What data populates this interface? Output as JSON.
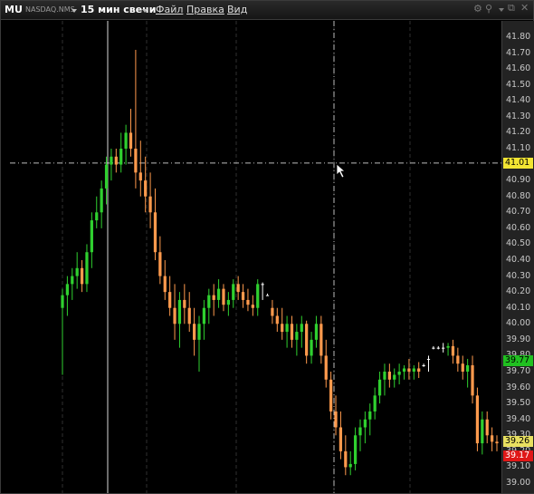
{
  "toolbar": {
    "symbol": "MU",
    "exchange": "NASDAQ.NMS",
    "interval": "15 мин свечи",
    "menu": [
      "Файл",
      "Правка",
      "Вид"
    ]
  },
  "price_axis": {
    "ticks": [
      "41.80",
      "41.70",
      "41.60",
      "41.50",
      "41.40",
      "41.30",
      "41.20",
      "41.10",
      "41.00",
      "40.90",
      "40.80",
      "40.70",
      "40.60",
      "40.50",
      "40.40",
      "40.30",
      "40.20",
      "40.10",
      "40.00",
      "39.90",
      "39.80",
      "39.70",
      "39.60",
      "39.50",
      "39.40",
      "39.30",
      "39.20",
      "39.10",
      "39.00"
    ],
    "crosshair_price": "41.01",
    "last_price": "39.26",
    "bid_price": "39.77",
    "ask_price": "39.17"
  },
  "colors": {
    "background": "#000000",
    "grid": "#303030",
    "up": "#2fd02f",
    "down": "#ff9a4d",
    "neutral": "#ffffff",
    "crosshair_label": "#f2e533",
    "bid_label": "#20c020",
    "ask_label": "#e01818"
  },
  "chart_data": {
    "type": "candlestick",
    "symbol": "MU",
    "interval": "15 мин",
    "ylim": [
      38.95,
      41.85
    ],
    "crosshair_y": 41.01,
    "candles": [
      [
        40.1,
        40.22,
        39.68,
        40.18
      ],
      [
        40.18,
        40.3,
        40.05,
        40.25
      ],
      [
        40.25,
        40.35,
        40.15,
        40.3
      ],
      [
        40.3,
        40.45,
        40.22,
        40.35
      ],
      [
        40.35,
        40.4,
        40.2,
        40.25
      ],
      [
        40.25,
        40.5,
        40.2,
        40.45
      ],
      [
        40.45,
        40.7,
        40.35,
        40.65
      ],
      [
        40.65,
        40.8,
        40.6,
        40.7
      ],
      [
        40.7,
        40.9,
        40.6,
        40.85
      ],
      [
        40.85,
        41.05,
        40.75,
        41.0
      ],
      [
        41.0,
        41.1,
        40.9,
        41.05
      ],
      [
        41.05,
        41.1,
        40.95,
        41.0
      ],
      [
        41.0,
        41.2,
        40.95,
        41.1
      ],
      [
        41.1,
        41.25,
        41.0,
        41.2
      ],
      [
        41.2,
        41.35,
        41.05,
        41.1
      ],
      [
        41.1,
        41.72,
        40.85,
        40.95
      ],
      [
        40.95,
        41.15,
        40.8,
        40.9
      ],
      [
        40.9,
        41.05,
        40.7,
        40.8
      ],
      [
        40.8,
        40.95,
        40.6,
        40.7
      ],
      [
        40.7,
        40.85,
        40.4,
        40.45
      ],
      [
        40.45,
        40.55,
        40.25,
        40.3
      ],
      [
        40.3,
        40.4,
        40.15,
        40.2
      ],
      [
        40.2,
        40.3,
        40.05,
        40.1
      ],
      [
        40.1,
        40.25,
        39.9,
        40.0
      ],
      [
        40.0,
        40.2,
        39.85,
        40.15
      ],
      [
        40.15,
        40.25,
        40.0,
        40.1
      ],
      [
        40.1,
        40.2,
        39.95,
        40.0
      ],
      [
        40.0,
        40.1,
        39.8,
        39.9
      ],
      [
        39.9,
        40.05,
        39.7,
        40.0
      ],
      [
        40.0,
        40.15,
        39.9,
        40.1
      ],
      [
        40.1,
        40.22,
        40.0,
        40.18
      ],
      [
        40.18,
        40.25,
        40.05,
        40.15
      ],
      [
        40.15,
        40.28,
        40.1,
        40.22
      ],
      [
        40.22,
        40.25,
        40.08,
        40.12
      ],
      [
        40.12,
        40.2,
        40.05,
        40.15
      ],
      [
        40.15,
        40.28,
        40.1,
        40.25
      ],
      [
        40.25,
        40.3,
        40.15,
        40.2
      ],
      [
        40.2,
        40.25,
        40.1,
        40.15
      ],
      [
        40.15,
        40.22,
        40.08,
        40.12
      ],
      [
        40.12,
        40.18,
        40.05,
        40.1
      ],
      [
        40.1,
        40.28,
        40.05,
        40.25
      ],
      [
        40.25,
        40.26,
        40.15,
        40.25
      ],
      [
        40.18,
        40.19,
        40.18,
        40.18
      ],
      [
        40.1,
        40.15,
        40.0,
        40.05
      ],
      [
        40.05,
        40.1,
        39.95,
        40.0
      ],
      [
        40.0,
        40.1,
        39.9,
        39.95
      ],
      [
        39.95,
        40.05,
        39.85,
        40.0
      ],
      [
        40.0,
        40.05,
        39.85,
        39.9
      ],
      [
        39.9,
        40.0,
        39.8,
        39.95
      ],
      [
        39.95,
        40.05,
        39.85,
        40.0
      ],
      [
        40.0,
        40.02,
        39.75,
        39.8
      ],
      [
        39.8,
        39.95,
        39.75,
        39.9
      ],
      [
        39.9,
        40.05,
        39.85,
        40.0
      ],
      [
        40.0,
        40.05,
        39.75,
        39.8
      ],
      [
        39.8,
        39.9,
        39.6,
        39.65
      ],
      [
        39.65,
        39.7,
        39.4,
        39.45
      ],
      [
        39.45,
        39.55,
        39.3,
        39.35
      ],
      [
        39.35,
        39.45,
        39.15,
        39.2
      ],
      [
        39.2,
        39.3,
        39.05,
        39.1
      ],
      [
        39.1,
        39.2,
        39.05,
        39.12
      ],
      [
        39.12,
        39.35,
        39.08,
        39.3
      ],
      [
        39.3,
        39.4,
        39.2,
        39.35
      ],
      [
        39.35,
        39.45,
        39.25,
        39.4
      ],
      [
        39.4,
        39.5,
        39.3,
        39.45
      ],
      [
        39.45,
        39.6,
        39.4,
        39.55
      ],
      [
        39.55,
        39.7,
        39.5,
        39.65
      ],
      [
        39.65,
        39.75,
        39.55,
        39.7
      ],
      [
        39.7,
        39.75,
        39.6,
        39.65
      ],
      [
        39.65,
        39.72,
        39.6,
        39.68
      ],
      [
        39.68,
        39.75,
        39.62,
        39.7
      ],
      [
        39.7,
        39.74,
        39.65,
        39.72
      ],
      [
        39.72,
        39.78,
        39.65,
        39.7
      ],
      [
        39.7,
        39.74,
        39.65,
        39.72
      ],
      [
        39.72,
        39.76,
        39.66,
        39.7
      ],
      [
        39.74,
        39.75,
        39.73,
        39.74
      ],
      [
        39.78,
        39.8,
        39.7,
        39.78
      ],
      [
        39.85,
        39.86,
        39.84,
        39.85
      ],
      [
        39.85,
        39.86,
        39.84,
        39.85
      ],
      [
        39.85,
        39.88,
        39.82,
        39.85
      ],
      [
        39.85,
        39.88,
        39.8,
        39.86
      ],
      [
        39.86,
        39.9,
        39.75,
        39.8
      ],
      [
        39.8,
        39.85,
        39.7,
        39.75
      ],
      [
        39.75,
        39.8,
        39.65,
        39.7
      ],
      [
        39.7,
        39.78,
        39.6,
        39.74
      ],
      [
        39.74,
        39.8,
        39.5,
        39.55
      ],
      [
        39.55,
        39.6,
        39.2,
        39.25
      ],
      [
        39.25,
        39.45,
        39.18,
        39.4
      ],
      [
        39.4,
        39.45,
        39.25,
        39.3
      ],
      [
        39.3,
        39.35,
        39.2,
        39.26
      ],
      [
        39.26,
        39.3,
        39.2,
        39.25
      ]
    ]
  }
}
